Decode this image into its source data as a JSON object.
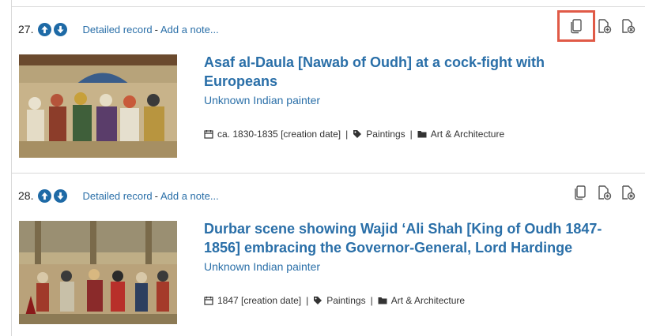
{
  "records": [
    {
      "number": "27.",
      "detailed_label": "Detailed record",
      "separator": "-",
      "note_label": "Add a note...",
      "title": "Asaf al-Daula [Nawab of Oudh] at a cock-fight with Europeans",
      "creator": "Unknown Indian painter",
      "date": "ca. 1830-1835 [creation date]",
      "type": "Paintings",
      "collection": "Art & Architecture",
      "copy_highlighted": true
    },
    {
      "number": "28.",
      "detailed_label": "Detailed record",
      "separator": "-",
      "note_label": "Add a note...",
      "title": "Durbar scene showing Wajid ‘Ali Shah [King of Oudh 1847-1856] embracing the Governor-General, Lord Hardinge",
      "creator": "Unknown Indian painter",
      "date": "1847 [creation date]",
      "type": "Paintings",
      "collection": "Art & Architecture",
      "copy_highlighted": false
    }
  ],
  "meta_separator": "|",
  "colors": {
    "link": "#2a6fa8",
    "arrow": "#1e6aa6",
    "highlight": "#e05a47",
    "rule": "#d9d9d9"
  }
}
